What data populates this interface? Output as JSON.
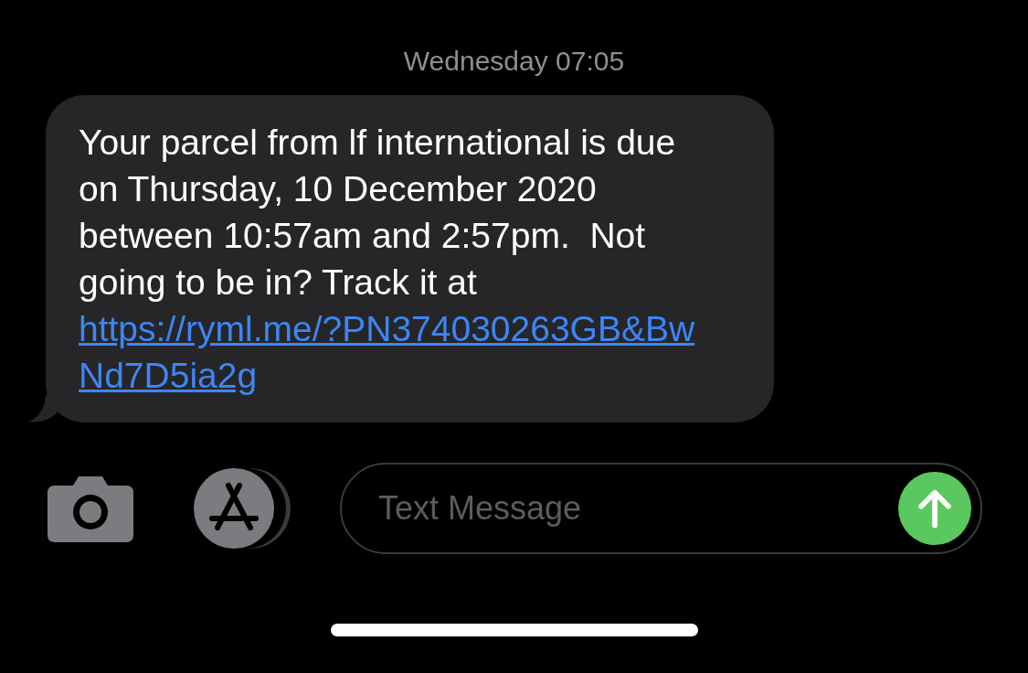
{
  "timestamp": "Wednesday 07:05",
  "messages": [
    {
      "text": "Your parcel from lf international is due on Thursday, 10 December 2020 between 10:57am and 2:57pm.  Not going to be in? Track it at ",
      "link": "https://ryml.me/?PN374030263GB&BwNd7D5ia2g"
    }
  ],
  "composer": {
    "placeholder": "Text Message"
  }
}
